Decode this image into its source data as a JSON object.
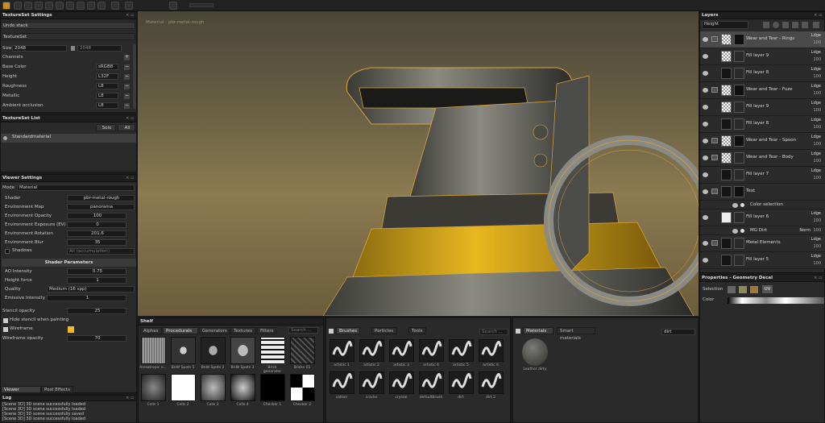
{
  "textureset": {
    "title": "TextureSet Settings",
    "undo": "Undo stack",
    "section": "TextureSet",
    "size_label": "Size",
    "size_value": "2048",
    "size_value2": "2048",
    "channels_label": "Channels",
    "channels": [
      {
        "name": "Base Color",
        "fmt": "sRGB8"
      },
      {
        "name": "Height",
        "fmt": "L32F"
      },
      {
        "name": "Roughness",
        "fmt": "L8"
      },
      {
        "name": "Metallic",
        "fmt": "L8"
      },
      {
        "name": "Ambient occlusion",
        "fmt": "L8"
      }
    ]
  },
  "tslist": {
    "title": "TextureSet List",
    "solo": "Solo",
    "all": "All",
    "item": "Standardmaterial"
  },
  "viewer": {
    "title": "Viewer Settings",
    "mode_label": "Mode",
    "mode_value": "Material",
    "shader_label": "Shader",
    "shader_value": "pbr-metal-rough",
    "envmap_label": "Environment Map",
    "envmap_value": "panorama",
    "opacity_label": "Environment Opacity",
    "opacity_value": "100",
    "exposure_label": "Environment Exposure (EV)",
    "exposure_value": "0",
    "rotation_label": "Environment Rotation",
    "rotation_value": "201.6",
    "blur_label": "Environment Blur",
    "blur_value": "35",
    "shadows_label": "Shadows",
    "shadows_value": "All (accumulation)",
    "shader_params": "Shader Parameters",
    "ao_label": "AO Intensity",
    "ao_value": "0.75",
    "height_label": "Height force",
    "height_value": "1",
    "quality_label": "Quality",
    "quality_value": "Medium (16 spp)",
    "emissive_label": "Emissive Intensity",
    "emissive_value": "1",
    "stencil_label": "Stencil opacity",
    "stencil_value": "25",
    "hide_stencil": "Hide stencil when painting",
    "wireframe": "Wireframe",
    "wire_opacity_label": "Wireframe opacity",
    "wire_opacity_value": "70",
    "tab1": "Viewer Settings",
    "tab2": "Post Effects"
  },
  "log": {
    "title": "Log",
    "lines": [
      "[Scene 3D] 3D scene successfully loaded",
      "[Scene 3D] 3D scene successfully loaded",
      "[Scene 3D] 3D scene successfully saved",
      "[Scene 3D] 3D scene successfully loaded"
    ]
  },
  "viewport": {
    "label": "Material - pbr-metal-rough"
  },
  "layers": {
    "title": "Layers",
    "mode": "Height",
    "items": [
      {
        "name": "Wear and Tear - Rings",
        "blend": "Ldge",
        "op": "100",
        "folder": true,
        "thumb": "checker"
      },
      {
        "name": "Fill layer 9",
        "blend": "Ldge",
        "op": "100",
        "folder": false,
        "thumb": "checker"
      },
      {
        "name": "Fill layer 8",
        "blend": "Ldge",
        "op": "100",
        "folder": false,
        "thumb": "dark"
      },
      {
        "name": "Wear and Tear - Fuze",
        "blend": "Ldge",
        "op": "100",
        "folder": true,
        "thumb": "checker"
      },
      {
        "name": "Fill layer 9",
        "blend": "Ldge",
        "op": "100",
        "folder": false,
        "thumb": "checker"
      },
      {
        "name": "Fill layer 8",
        "blend": "Ldge",
        "op": "100",
        "folder": false,
        "thumb": "dark"
      },
      {
        "name": "Wear and Tear - Spoon",
        "blend": "Ldge",
        "op": "100",
        "folder": true,
        "thumb": "checker"
      },
      {
        "name": "Wear and Tear - Body",
        "blend": "Ldge",
        "op": "100",
        "folder": true,
        "thumb": "checker"
      },
      {
        "name": "Fill layer 7",
        "blend": "Ldge",
        "op": "100",
        "folder": false,
        "thumb": "dark"
      },
      {
        "name": "Text",
        "blend": "",
        "op": "",
        "folder": true,
        "thumb": "dark"
      },
      {
        "name": "Color selection",
        "blend": "",
        "op": "",
        "folder": false,
        "thumb": "none"
      },
      {
        "name": "Fill layer 6",
        "blend": "Ldge",
        "op": "100",
        "folder": false,
        "thumb": "white"
      },
      {
        "name": "MG Dirt",
        "blend": "Norm",
        "op": "100",
        "folder": false,
        "thumb": "none"
      },
      {
        "name": "Metal Elements",
        "blend": "Ldge",
        "op": "100",
        "folder": true,
        "thumb": "dark"
      },
      {
        "name": "Fill layer 5",
        "blend": "Ldge",
        "op": "100",
        "folder": false,
        "thumb": "dark"
      }
    ]
  },
  "props": {
    "title": "Properties - Geometry Decal",
    "selection": "Selection",
    "color": "Color",
    "uv": "UV"
  },
  "shelf": {
    "title": "Shelf",
    "tabs": [
      "Alphas",
      "Procedurals",
      "Generators",
      "Textures",
      "Filters"
    ],
    "search": "Search ...",
    "tiles": [
      {
        "name": "Anisotropic n..."
      },
      {
        "name": "BnW Spots 1"
      },
      {
        "name": "BnW Spots 2"
      },
      {
        "name": "BnW Spots 3"
      },
      {
        "name": "Brick generator"
      },
      {
        "name": "Bricks 01"
      },
      {
        "name": "Cells 1"
      },
      {
        "name": "Cells 2"
      },
      {
        "name": "Cells 3"
      },
      {
        "name": "Cells 4"
      },
      {
        "name": "Checker 1"
      },
      {
        "name": "Checker 2"
      }
    ],
    "brush_tabs": [
      "Brushes",
      "Particles",
      "Tools"
    ],
    "brush_search": "Search ...",
    "brushes": [
      {
        "name": "artistic 1"
      },
      {
        "name": "artistic 2"
      },
      {
        "name": "artistic 3"
      },
      {
        "name": "artistic 4"
      },
      {
        "name": "artistic 5"
      },
      {
        "name": "artistic 6"
      },
      {
        "name": "cotton"
      },
      {
        "name": "cracks"
      },
      {
        "name": "crystal"
      },
      {
        "name": "defaultbrush"
      },
      {
        "name": "dirt"
      },
      {
        "name": "dirt 2"
      }
    ],
    "mat_tabs": [
      "Materials",
      "Smart materials"
    ],
    "mat_search": "dirt",
    "mat_item": "Leather dirty"
  }
}
